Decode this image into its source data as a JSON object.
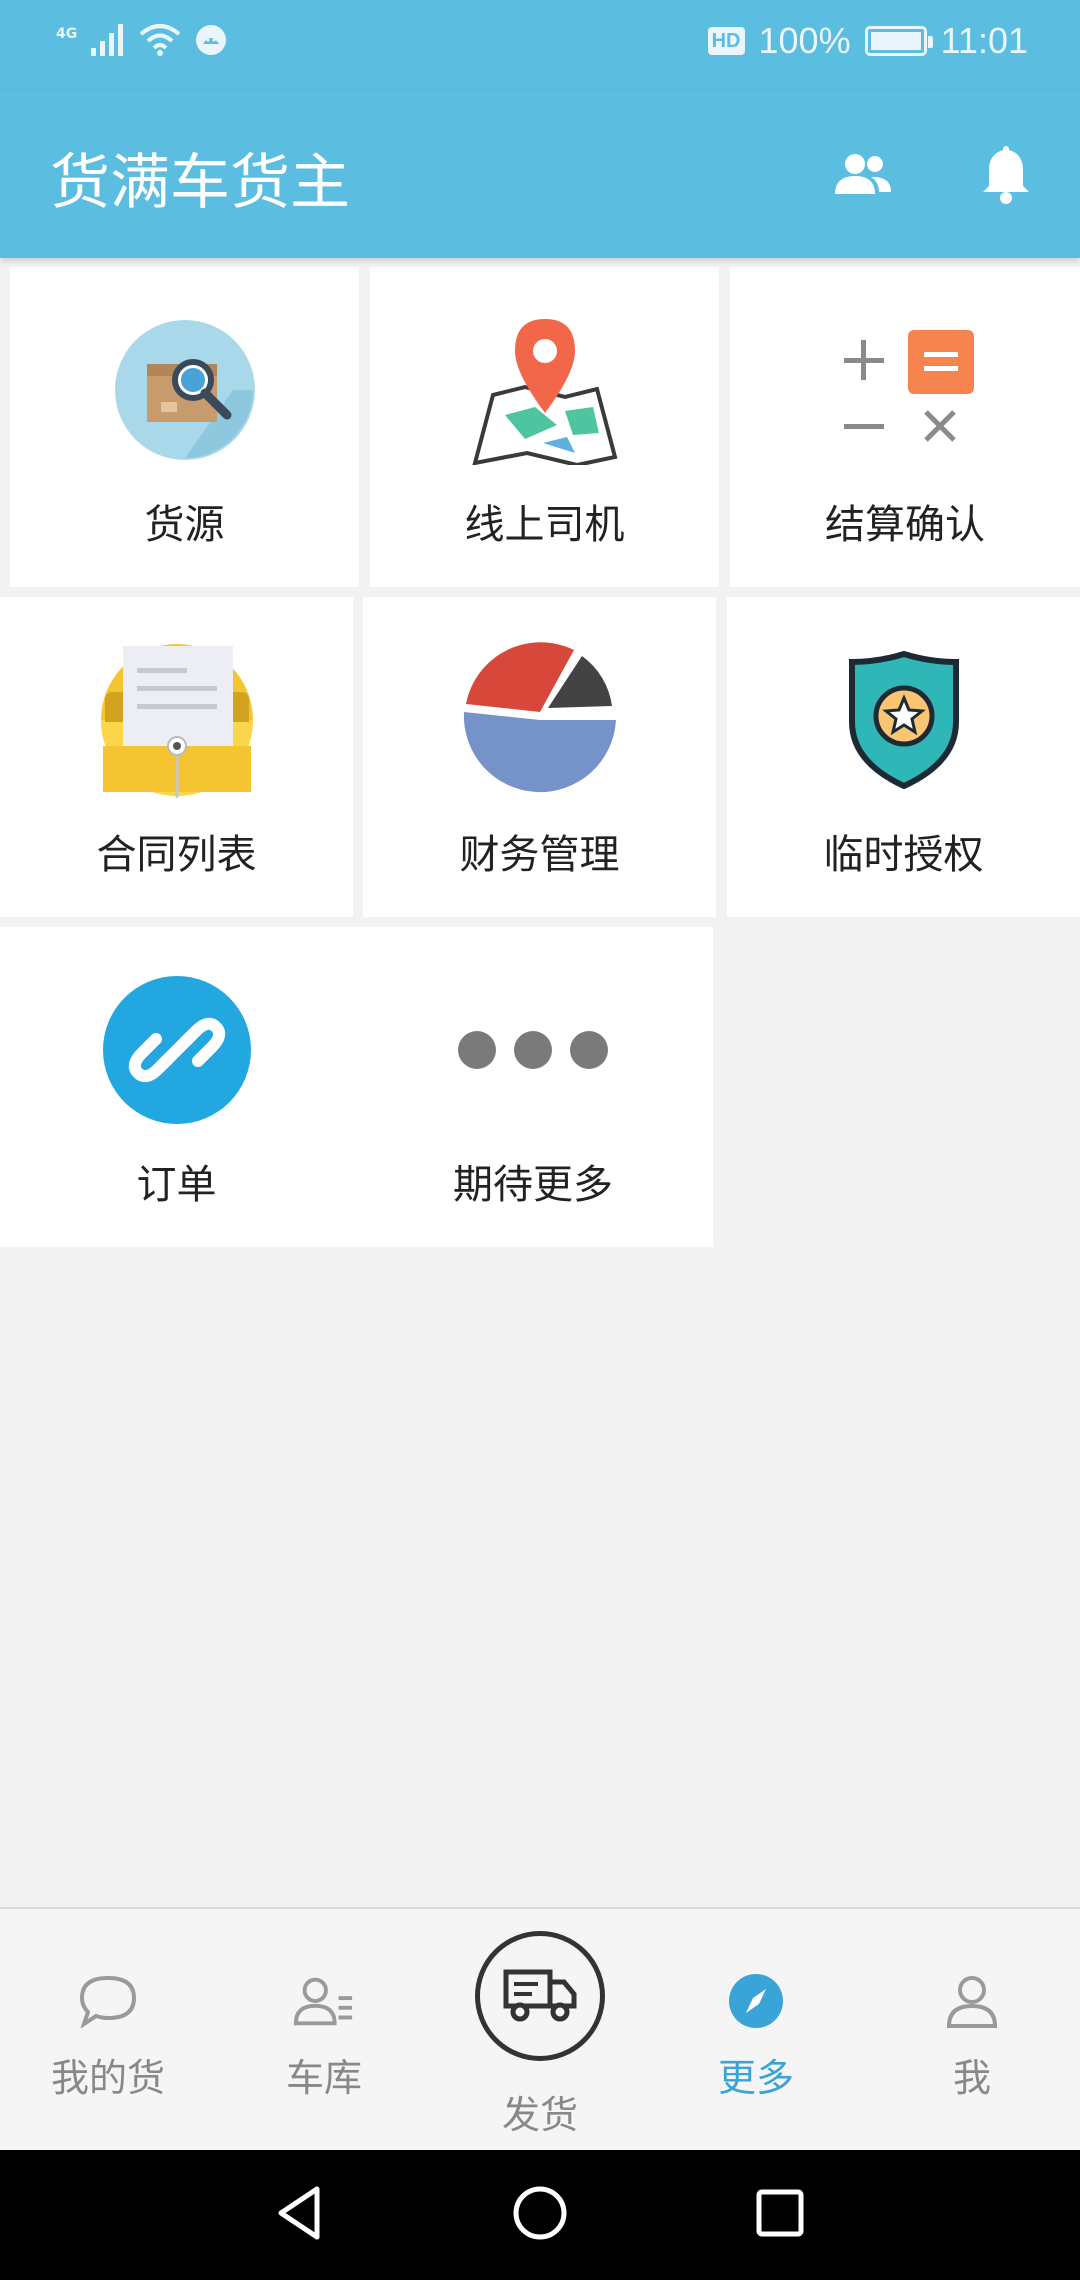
{
  "status_bar": {
    "network": "4G",
    "hd": "HD",
    "battery": "100%",
    "time": "11:01"
  },
  "app_bar": {
    "title": "货满车货主",
    "icons": [
      "contacts-icon",
      "bell-icon"
    ]
  },
  "tiles": [
    {
      "label": "货源",
      "icon": "cargo-search-icon"
    },
    {
      "label": "线上司机",
      "icon": "map-pin-icon"
    },
    {
      "label": "结算确认",
      "icon": "calculator-icon"
    },
    {
      "label": "合同列表",
      "icon": "envelope-document-icon"
    },
    {
      "label": "财务管理",
      "icon": "pie-chart-icon"
    },
    {
      "label": "临时授权",
      "icon": "shield-star-icon"
    },
    {
      "label": "订单",
      "icon": "link-icon"
    },
    {
      "label": "期待更多",
      "icon": "more-dots-icon"
    }
  ],
  "bottom_nav": {
    "items": [
      {
        "label": "我的货",
        "icon": "chat-bubble-icon"
      },
      {
        "label": "车库",
        "icon": "user-list-icon"
      },
      {
        "label": "发货",
        "icon": "truck-icon"
      },
      {
        "label": "更多",
        "icon": "compass-icon"
      },
      {
        "label": "我",
        "icon": "user-icon"
      }
    ],
    "active": "更多"
  },
  "colors": {
    "primary": "#5bbde0",
    "active": "#3aa3d8",
    "background": "#f2f2f2"
  }
}
